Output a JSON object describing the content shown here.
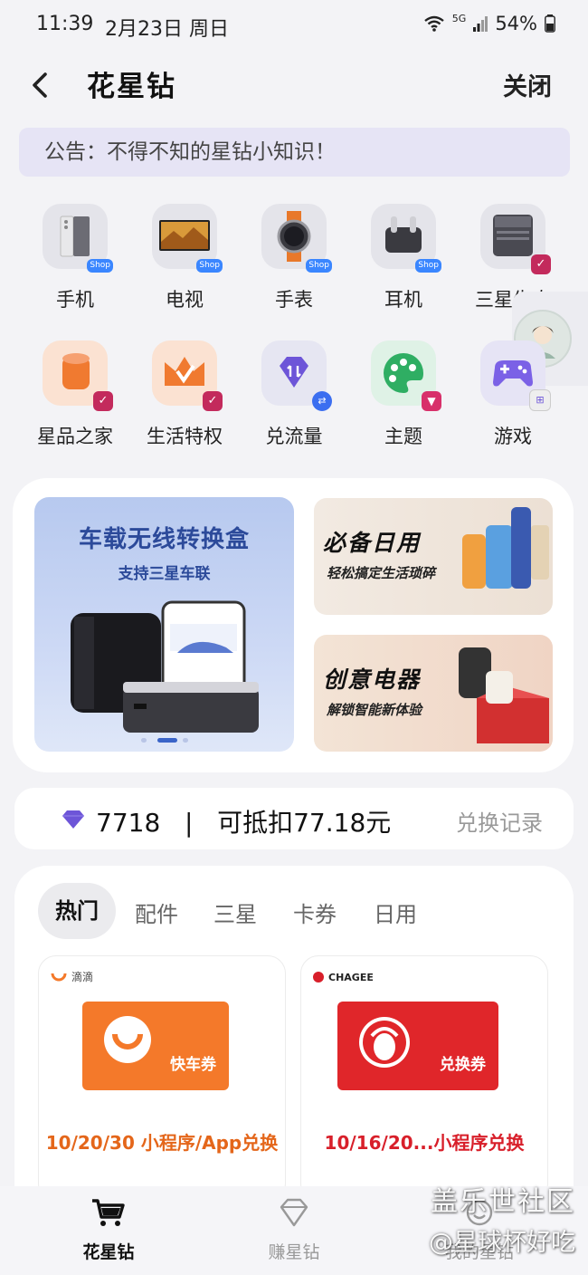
{
  "status": {
    "time": "11:39",
    "date": "2月23日 周日",
    "battery": "54%",
    "signal_label": "5G"
  },
  "header": {
    "title": "花星钻",
    "close_label": "关闭"
  },
  "notice": {
    "text": "公告：不得不知的星钻小知识！"
  },
  "categories_row1": [
    {
      "label": "手机",
      "badge": "Shop"
    },
    {
      "label": "电视",
      "badge": "Shop"
    },
    {
      "label": "手表",
      "badge": "Shop"
    },
    {
      "label": "耳机",
      "badge": "Shop"
    },
    {
      "label": "三星生态",
      "badge": ""
    }
  ],
  "categories_row2": [
    {
      "label": "星品之家"
    },
    {
      "label": "生活特权"
    },
    {
      "label": "兑流量"
    },
    {
      "label": "主题"
    },
    {
      "label": "游戏"
    }
  ],
  "banners": {
    "main_title": "车载无线转换盒",
    "main_subtitle": "支持三星车联",
    "side1_title": "必备日用",
    "side1_subtitle": "轻松搞定生活琐碎",
    "side2_title": "创意电器",
    "side2_subtitle": "解锁智能新体验"
  },
  "points": {
    "value": "7718",
    "separator": "|",
    "deduct": "可抵扣77.18元",
    "record_label": "兑换记录"
  },
  "tabs": [
    "热门",
    "配件",
    "三星",
    "卡券",
    "日用"
  ],
  "products": [
    {
      "brand": "滴滴",
      "coupon_label": "快车券",
      "price": "10/20/30 小程序/App兑换"
    },
    {
      "brand": "CHAGEE",
      "coupon_label": "兑换券",
      "price": "10/16/20...小程序兑换"
    }
  ],
  "bottom_nav": [
    {
      "label": "花星钻"
    },
    {
      "label": "赚星钻"
    },
    {
      "label": "我的星钻"
    }
  ],
  "watermark": {
    "line1": "盖乐世社区",
    "line2": "@星球杯好吃"
  },
  "colors": {
    "accent_orange": "#f4792a",
    "accent_red": "#e0262a",
    "price_orange": "#e4661a",
    "price_red": "#d81f2a"
  }
}
